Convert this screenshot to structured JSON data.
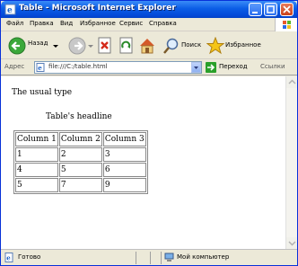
{
  "window": {
    "title": "Table - Microsoft Internet Explorer"
  },
  "menu": [
    "Файл",
    "Правка",
    "Вид",
    "Избранное",
    "Сервис",
    "Справка"
  ],
  "toolbar": {
    "back_label": "Назад",
    "search_label": "Поиск",
    "favorites_label": "Избранное"
  },
  "address": {
    "label": "Адрес",
    "value": "file:///C:/table.html",
    "go_label": "Переход",
    "links_label": "Ссылки"
  },
  "page": {
    "text": "The usual type",
    "caption": "Table's headline",
    "table": {
      "headers": [
        "Column 1",
        "Column 2",
        "Column 3"
      ],
      "rows": [
        [
          "1",
          "2",
          "3"
        ],
        [
          "4",
          "5",
          "6"
        ],
        [
          "5",
          "7",
          "9"
        ]
      ]
    }
  },
  "status": {
    "text": "Готово",
    "zone": "Мой компьютер"
  }
}
